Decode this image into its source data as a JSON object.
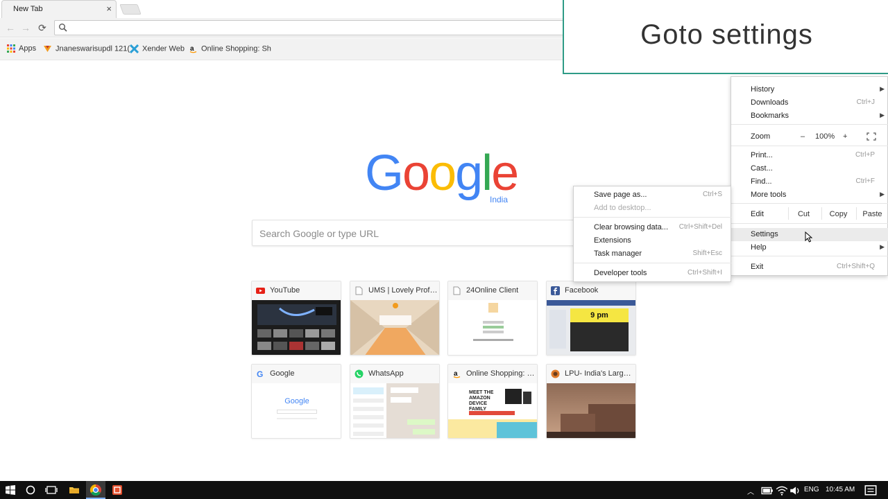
{
  "browser": {
    "tab_title": "New Tab",
    "tab_close": "×",
    "nav_back": "←",
    "nav_forward": "→",
    "nav_reload": "⟳"
  },
  "bookmarks": [
    {
      "label": "Apps",
      "icon": "apps-grid-icon"
    },
    {
      "label": "Jnaneswarisupdl 121(",
      "icon": "dl-icon"
    },
    {
      "label": "Xender Web",
      "icon": "xender-icon"
    },
    {
      "label": "Online Shopping: Sh",
      "icon": "amazon-icon"
    }
  ],
  "google": {
    "logo_letters": [
      "G",
      "o",
      "o",
      "g",
      "l",
      "e"
    ],
    "logo_colors": [
      "#4285f4",
      "#ea4335",
      "#fbbc05",
      "#4285f4",
      "#34a853",
      "#ea4335"
    ],
    "region": "India",
    "search_placeholder": "Search Google or type URL"
  },
  "tiles": [
    {
      "title": "YouTube",
      "icon": "youtube-icon"
    },
    {
      "title": "UMS | Lovely Profe...",
      "icon": "page-icon"
    },
    {
      "title": "24Online Client",
      "icon": "page-icon"
    },
    {
      "title": "Facebook",
      "icon": "facebook-icon"
    },
    {
      "title": "Google",
      "icon": "google-icon"
    },
    {
      "title": "WhatsApp",
      "icon": "whatsapp-icon"
    },
    {
      "title": "Online Shopping: S...",
      "icon": "amazon-icon"
    },
    {
      "title": "LPU- India's Larges...",
      "icon": "lpu-icon"
    }
  ],
  "thumb_texts": {
    "facebook_time": "9 pm",
    "google_mini": "Google",
    "amazon_banner": "MEET THE AMAZON DEVICE FAMILY"
  },
  "caption": "Goto settings",
  "menu": {
    "history": "History",
    "downloads": "Downloads",
    "downloads_sc": "Ctrl+J",
    "bookmarks": "Bookmarks",
    "zoom": "Zoom",
    "zoom_minus": "–",
    "zoom_level": "100%",
    "zoom_plus": "+",
    "print": "Print...",
    "print_sc": "Ctrl+P",
    "cast": "Cast...",
    "find": "Find...",
    "find_sc": "Ctrl+F",
    "more_tools": "More tools",
    "edit": "Edit",
    "cut": "Cut",
    "copy": "Copy",
    "paste": "Paste",
    "settings": "Settings",
    "help": "Help",
    "exit": "Exit",
    "exit_sc": "Ctrl+Shift+Q"
  },
  "submenu": {
    "save_page": "Save page as...",
    "save_page_sc": "Ctrl+S",
    "add_desktop": "Add to desktop...",
    "clear_data": "Clear browsing data...",
    "clear_data_sc": "Ctrl+Shift+Del",
    "extensions": "Extensions",
    "task_manager": "Task manager",
    "task_manager_sc": "Shift+Esc",
    "dev_tools": "Developer tools",
    "dev_tools_sc": "Ctrl+Shift+I"
  },
  "taskbar": {
    "language": "ENG",
    "time": "10:45 AM"
  }
}
